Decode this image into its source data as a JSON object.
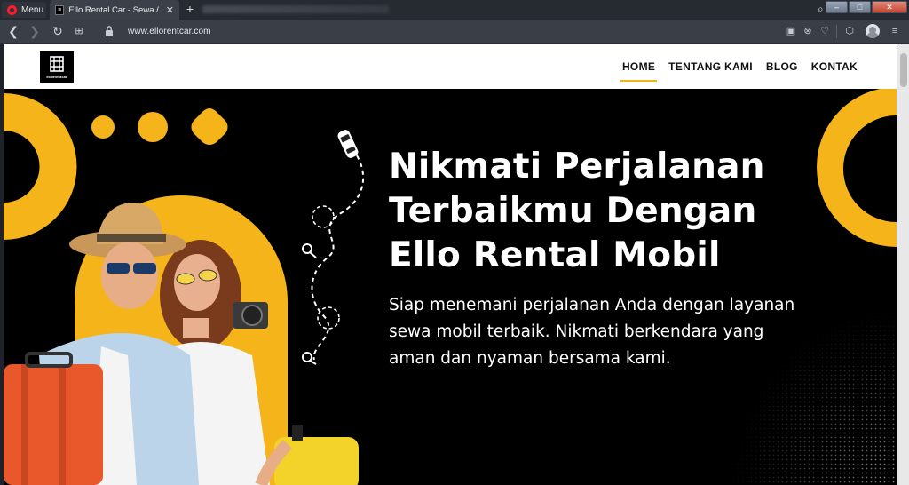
{
  "browser": {
    "menu_label": "Menu",
    "tab": {
      "title": "Ello Rental Car - Sewa / Rental",
      "favicon": "ello-logo-favicon"
    },
    "url": "www.ellorentcar.com",
    "icons": [
      "back-icon",
      "forward-icon",
      "reload-icon",
      "speed-dial-icon",
      "lock-icon",
      "camera-icon",
      "adblock-icon",
      "heart-icon",
      "cube-icon",
      "profile-icon",
      "easy-setup-icon"
    ]
  },
  "site": {
    "logo_text": "ElloRentcar",
    "nav": [
      {
        "label": "HOME",
        "active": true
      },
      {
        "label": "TENTANG KAMI",
        "active": false
      },
      {
        "label": "BLOG",
        "active": false
      },
      {
        "label": "KONTAK",
        "active": false
      }
    ],
    "hero": {
      "title": "Nikmati Perjalanan Terbaikmu Dengan Ello Rental Mobil",
      "subtitle": "Siap menemani perjalanan Anda dengan layanan sewa mobil terbaik. Nikmati berkendara yang aman dan nyaman bersama kami."
    }
  },
  "colors": {
    "accent": "#f5b41a",
    "hero_bg": "#000000",
    "browser_dark": "#262a31"
  }
}
